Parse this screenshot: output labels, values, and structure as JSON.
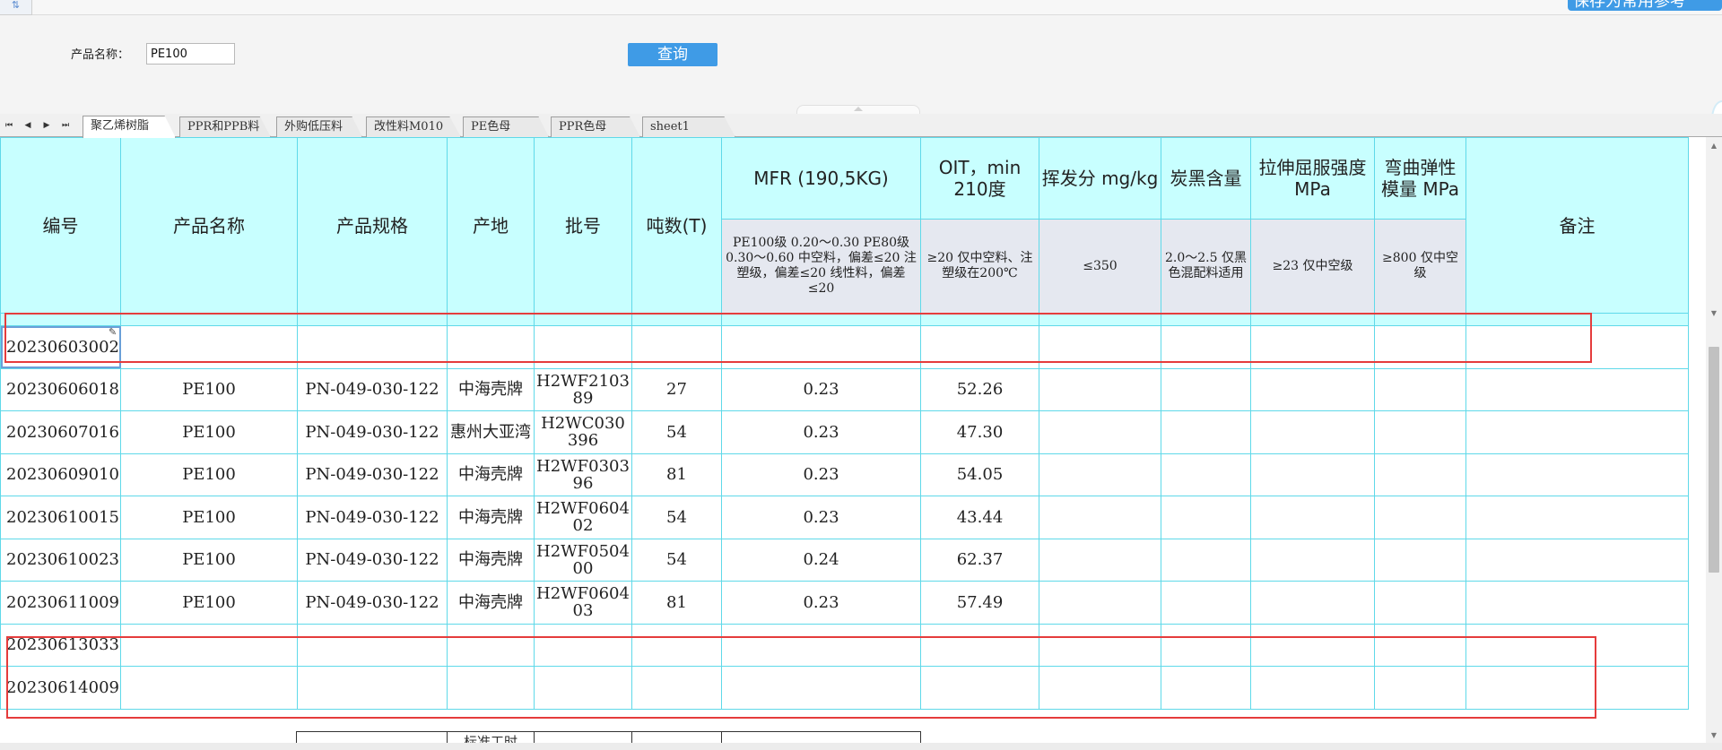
{
  "topbar": {
    "corner_icon": "filter-icon",
    "corner_glyph": "⇅",
    "right_button_label": "保存为常用参考"
  },
  "form": {
    "name_label": "产品名称：",
    "name_value": "PE100",
    "query_label": "查询"
  },
  "sheet_nav": {
    "first": "⏮",
    "prev": "◀",
    "next": "▶",
    "last": "⏭"
  },
  "tabs": [
    {
      "label": "聚乙烯树脂",
      "active": true
    },
    {
      "label": "PPR和PPB料",
      "active": false
    },
    {
      "label": "外购低压料",
      "active": false
    },
    {
      "label": "改性料M010",
      "active": false
    },
    {
      "label": "PE色母",
      "active": false
    },
    {
      "label": "PPR色母",
      "active": false
    },
    {
      "label": "sheet1",
      "active": false
    }
  ],
  "table": {
    "headers": {
      "id": "编号",
      "product_name": "产品名称",
      "spec": "产品规格",
      "origin": "产地",
      "batch": "批号",
      "tons": "吨数(T)",
      "mfr": "MFR (190,5KG)",
      "oit": "OIT，min 210度",
      "volatile": "挥发分 mg/kg",
      "carbon": "炭黑含量",
      "tensile": "拉伸屈服强度 MPa",
      "flex": "弯曲弹性模量 MPa",
      "remark": "备注"
    },
    "subheaders": {
      "mfr": "PE100级 0.20～0.30 PE80级 0.30～0.60 中空料，偏差≤20 注塑级，偏差≤20 线性料，偏差≤20",
      "oit": "≥20 仅中空料、注塑级在200℃",
      "volatile": "≤350",
      "carbon": "2.0～2.5 仅黑色混配料适用",
      "tensile": "≥23 仅中空级",
      "flex": "≥800 仅中空级"
    },
    "rows": [
      {
        "id": "20230603002",
        "product_name": "",
        "spec": "",
        "origin": "",
        "batch": "",
        "tons": "",
        "mfr": "",
        "oit": "",
        "volatile": "",
        "carbon": "",
        "tensile": "",
        "flex": "",
        "remark": ""
      },
      {
        "id": "20230606018",
        "product_name": "PE100",
        "spec": "PN-049-030-122",
        "origin": "中海壳牌",
        "batch": "H2WF210389",
        "tons": "27",
        "mfr": "0.23",
        "oit": "52.26",
        "volatile": "",
        "carbon": "",
        "tensile": "",
        "flex": "",
        "remark": ""
      },
      {
        "id": "20230607016",
        "product_name": "PE100",
        "spec": "PN-049-030-122",
        "origin": "惠州大亚湾",
        "batch": "H2WC030396",
        "tons": "54",
        "mfr": "0.23",
        "oit": "47.30",
        "volatile": "",
        "carbon": "",
        "tensile": "",
        "flex": "",
        "remark": ""
      },
      {
        "id": "20230609010",
        "product_name": "PE100",
        "spec": "PN-049-030-122",
        "origin": "中海壳牌",
        "batch": "H2WF030396",
        "tons": "81",
        "mfr": "0.23",
        "oit": "54.05",
        "volatile": "",
        "carbon": "",
        "tensile": "",
        "flex": "",
        "remark": ""
      },
      {
        "id": "20230610015",
        "product_name": "PE100",
        "spec": "PN-049-030-122",
        "origin": "中海壳牌",
        "batch": "H2WF060402",
        "tons": "54",
        "mfr": "0.23",
        "oit": "43.44",
        "volatile": "",
        "carbon": "",
        "tensile": "",
        "flex": "",
        "remark": ""
      },
      {
        "id": "20230610023",
        "product_name": "PE100",
        "spec": "PN-049-030-122",
        "origin": "中海壳牌",
        "batch": "H2WF050400",
        "tons": "54",
        "mfr": "0.24",
        "oit": "62.37",
        "volatile": "",
        "carbon": "",
        "tensile": "",
        "flex": "",
        "remark": ""
      },
      {
        "id": "20230611009",
        "product_name": "PE100",
        "spec": "PN-049-030-122",
        "origin": "中海壳牌",
        "batch": "H2WF060403",
        "tons": "81",
        "mfr": "0.23",
        "oit": "57.49",
        "volatile": "",
        "carbon": "",
        "tensile": "",
        "flex": "",
        "remark": ""
      },
      {
        "id": "20230613033",
        "product_name": "",
        "spec": "",
        "origin": "",
        "batch": "",
        "tons": "",
        "mfr": "",
        "oit": "",
        "volatile": "",
        "carbon": "",
        "tensile": "",
        "flex": "",
        "remark": ""
      },
      {
        "id": "20230614009",
        "product_name": "",
        "spec": "",
        "origin": "",
        "batch": "",
        "tons": "",
        "mfr": "",
        "oit": "",
        "volatile": "",
        "carbon": "",
        "tensile": "",
        "flex": "",
        "remark": ""
      }
    ]
  },
  "subtable": {
    "cells": [
      "",
      "标准工时",
      "",
      "",
      ""
    ]
  },
  "colors": {
    "header_bg": "#c8ffff",
    "subheader_bg": "#e5e8f0",
    "grid_line": "#5fd9e9",
    "highlight": "#e53c3c",
    "button": "#3f9be6"
  }
}
